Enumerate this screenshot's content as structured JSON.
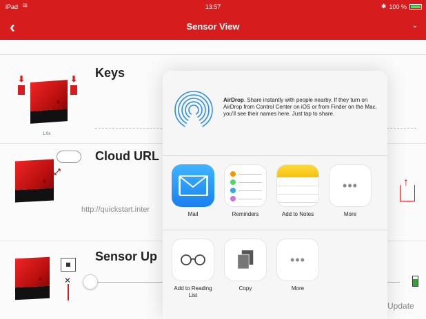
{
  "status": {
    "carrier": "iPad",
    "time": "13:57",
    "battery": "100 %",
    "battery_level": 1.0
  },
  "nav": {
    "title": "Sensor View",
    "back_icon": "chevron-left-icon",
    "menu_icon": "chevron-down-icon"
  },
  "rows": {
    "keys": {
      "title": "Keys",
      "time_label": "1.0s"
    },
    "cloud": {
      "title": "Cloud URL",
      "url": "http://quickstart.inter"
    },
    "sensor": {
      "title": "Sensor Up",
      "update": "Update"
    }
  },
  "share_sheet": {
    "airdrop_title": "AirDrop",
    "airdrop_text": ". Share instantly with people nearby. If they turn on AirDrop from Control Center on iOS or from Finder on the Mac, you'll see their names here. Just tap to share.",
    "apps": [
      {
        "label": "Mail",
        "icon": "mail-icon"
      },
      {
        "label": "Reminders",
        "icon": "reminders-icon"
      },
      {
        "label": "Add to Notes",
        "icon": "notes-icon"
      },
      {
        "label": "More",
        "icon": "more-icon"
      }
    ],
    "actions": [
      {
        "label": "Add to Reading List",
        "icon": "glasses-icon"
      },
      {
        "label": "Copy",
        "icon": "copy-icon"
      },
      {
        "label": "More",
        "icon": "more-icon"
      }
    ],
    "more_glyph": "•••"
  },
  "colors": {
    "brand": "#d61c1c",
    "mail_blue": "#1b7ff1",
    "notes_yellow": "#f4c20d"
  }
}
